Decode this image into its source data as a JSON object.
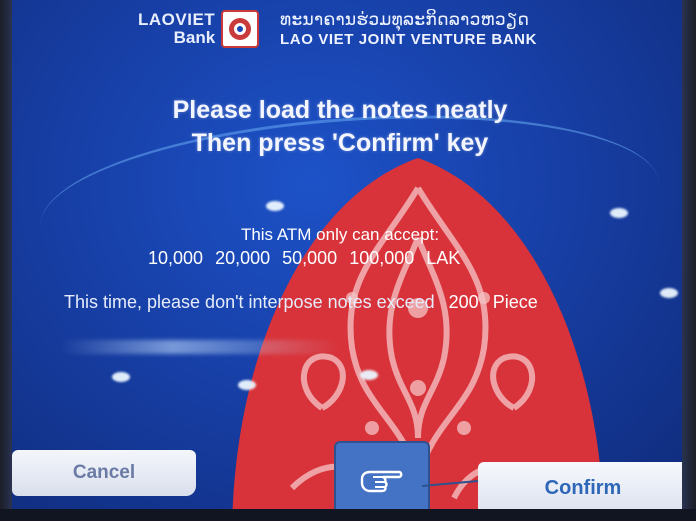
{
  "header": {
    "logo_line1": "LAOVIET",
    "logo_line2": "Bank",
    "bank_name_lao": "ທະນາຄານຮ່ວມທຸລະກິດລາວຫວຽດ",
    "bank_name_en": "LAO VIET JOINT VENTURE BANK"
  },
  "instructions": {
    "line1": "Please load the notes neatly",
    "line2": "Then press 'Confirm' key"
  },
  "accepted": {
    "title": "This ATM only can accept:",
    "denominations": [
      "10,000",
      "20,000",
      "50,000",
      "100,000"
    ],
    "currency": "LAK"
  },
  "limit": {
    "text": "This time, please don't interpose notes exceed",
    "count": "200",
    "unit": "Piece"
  },
  "buttons": {
    "cancel_label": "Cancel",
    "confirm_label": "Confirm"
  },
  "icons": {
    "pointer": "hand-pointer-icon",
    "logo": "bank-logo-icon"
  },
  "colors": {
    "screen_blue": "#1a47b8",
    "ornament_red": "#d8333a",
    "callout_blue": "#4472c4"
  }
}
